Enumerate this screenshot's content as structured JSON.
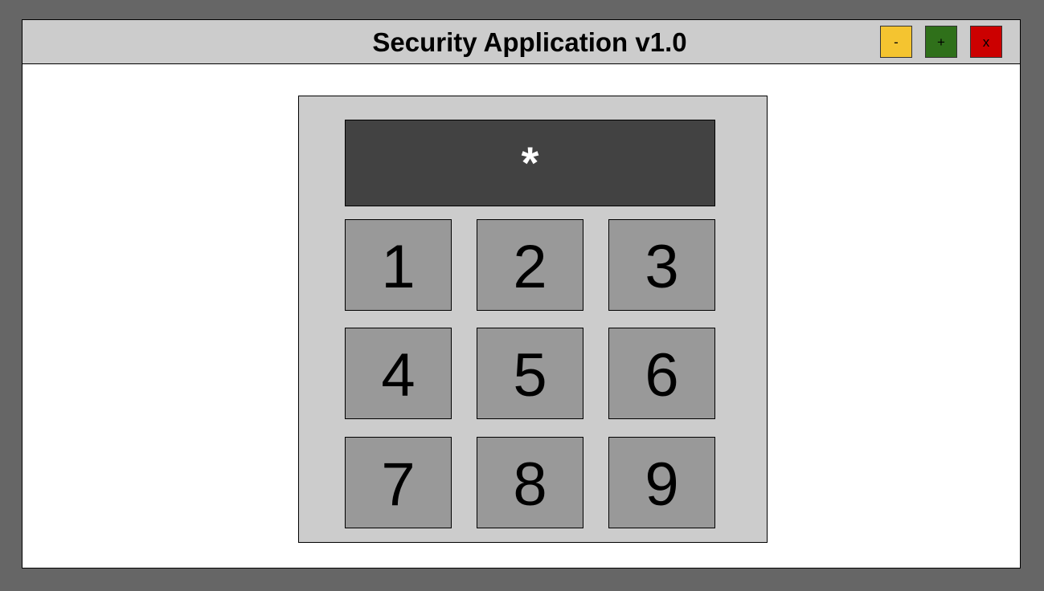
{
  "window": {
    "title": "Security Application v1.0",
    "controls": {
      "minimize_label": "-",
      "maximize_label": "+",
      "close_label": "x"
    }
  },
  "keypad": {
    "display_value": "*",
    "keys": [
      "1",
      "2",
      "3",
      "4",
      "5",
      "6",
      "7",
      "8",
      "9"
    ]
  },
  "colors": {
    "minimize": "#f4c430",
    "maximize": "#2f701a",
    "close": "#cc0000",
    "display": "#424242",
    "key": "#999999",
    "panel": "#cccccc"
  }
}
